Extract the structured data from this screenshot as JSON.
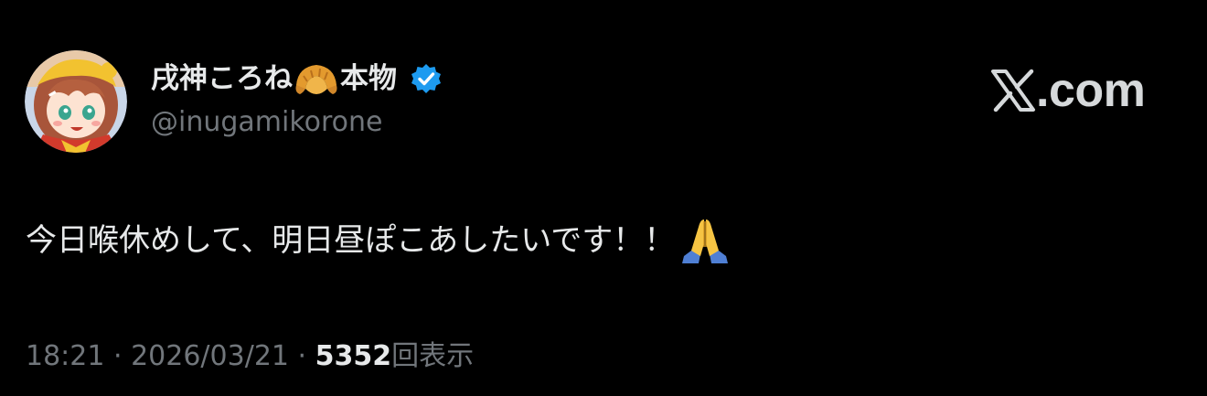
{
  "author": {
    "display_name_prefix": "戌神ころね",
    "display_name_suffix": "本物",
    "handle": "@inugamikorone",
    "verified": true,
    "avatar_icon": "anime-girl-avatar"
  },
  "brand": {
    "label": ".com",
    "icon": "x-logo-icon"
  },
  "tweet": {
    "text": "今日喉休めして、明日昼ぽこあしたいです！！",
    "trailing_emoji": "folded-hands-icon"
  },
  "meta": {
    "time": "18:21",
    "separator_1": " · ",
    "date": "2026/03/21",
    "separator_2": " · ",
    "views_count": "5352",
    "views_label": "回表示"
  },
  "colors": {
    "background": "#000000",
    "primary_text": "#e7e9ea",
    "secondary_text": "#71767b",
    "verified_blue": "#1d9bf0"
  }
}
